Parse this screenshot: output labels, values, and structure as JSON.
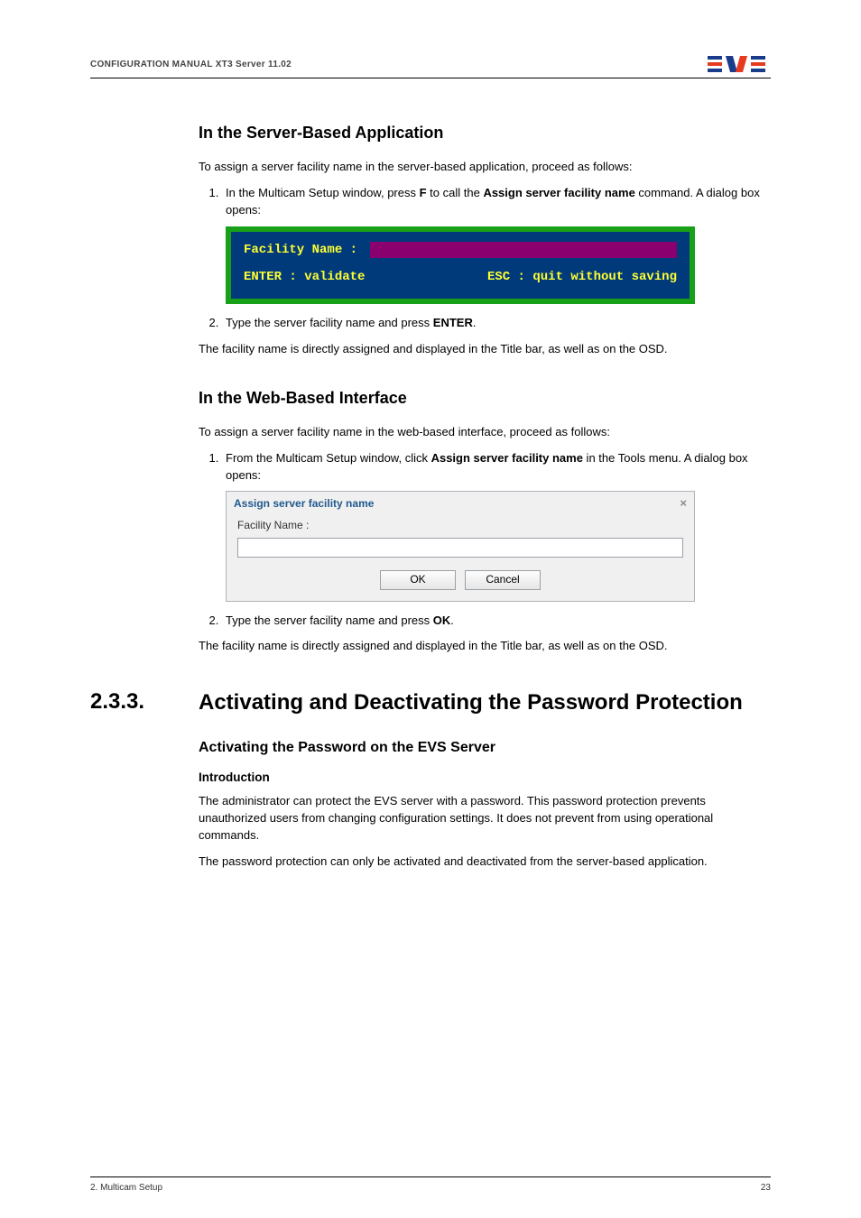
{
  "header": {
    "title": "CONFIGURATION MANUAL XT3 Server 11.02",
    "logo_alt": "EVS"
  },
  "s1": {
    "heading": "In the Server-Based Application",
    "intro": "To assign a server facility name in the server-based application, proceed as follows:",
    "step1_a": "In the Multicam Setup window, press ",
    "step1_key": "F",
    "step1_b": " to call the ",
    "step1_cmd": "Assign server facility name",
    "step1_c": " command. A dialog box opens:",
    "term_label": "Facility Name :",
    "term_enter": "ENTER : validate",
    "term_esc": "ESC : quit without saving",
    "step2_a": "Type the server facility name and press ",
    "step2_key": "ENTER",
    "step2_b": ".",
    "outro": "The facility name is directly assigned and displayed in the Title bar, as well as on the OSD."
  },
  "s2": {
    "heading": "In the Web-Based Interface",
    "intro": "To assign a server facility name in the web-based interface, proceed as follows:",
    "step1_a": "From the Multicam Setup window, click ",
    "step1_cmd": "Assign server facility name",
    "step1_b": " in the Tools menu. A dialog box opens:",
    "dialog_title": "Assign server facility name",
    "dialog_label": "Facility Name :",
    "dialog_ok": "OK",
    "dialog_cancel": "Cancel",
    "step2_a": "Type the server facility name and press ",
    "step2_key": "OK",
    "step2_b": ".",
    "outro": "The facility name is directly assigned and displayed in the Title bar, as well as on the OSD."
  },
  "s3": {
    "number": "2.3.3.",
    "title": "Activating and Deactivating the Password Protection",
    "sub1": "Activating the Password on the EVS Server",
    "sub2": "Introduction",
    "p1": "The administrator can protect the EVS server with a password. This password protection prevents unauthorized users from changing configuration settings. It does not prevent from using operational commands.",
    "p2": "The password protection can only be activated and deactivated from the server-based application."
  },
  "footer": {
    "left": "2. Multicam Setup",
    "right": "23"
  }
}
